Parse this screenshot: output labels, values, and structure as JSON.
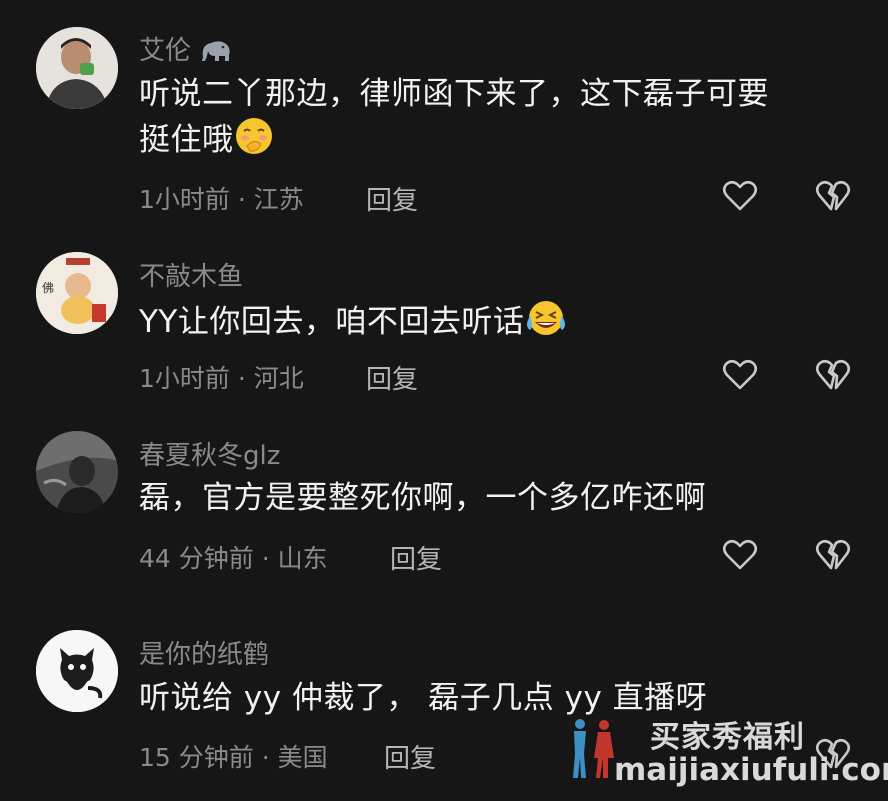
{
  "comments": [
    {
      "username": "艾伦",
      "username_badge": "elephant-icon",
      "text_line1": "听说二丫那边，律师函下来了，这下磊子可要",
      "text_line2": "挺住哦",
      "trailing_emoji": "blush-hand-emoji",
      "time": "1小时前",
      "location": "江苏",
      "reply": "回复"
    },
    {
      "username": "不敲木鱼",
      "text_line1": "YY让你回去，咱不回去听话",
      "trailing_emoji": "laughing-tears-emoji",
      "time": "1小时前",
      "location": "河北",
      "reply": "回复"
    },
    {
      "username": "春夏秋冬glz",
      "text_line1": "磊，官方是要整死你啊，一个多亿咋还啊",
      "time": "44 分钟前",
      "location": "山东",
      "reply": "回复"
    },
    {
      "username": "是你的纸鹤",
      "text_line1": "听说给 yy 仲裁了， 磊子几点 yy 直播呀",
      "time": "15 分钟前",
      "location": "美国",
      "reply": "回复"
    }
  ],
  "separator": " · ",
  "watermark": {
    "title": "买家秀福利",
    "url": "maijiaxiufuli.com"
  },
  "colors": {
    "background": "#161616",
    "text_primary": "#f2f2f2",
    "text_secondary": "#8a8a8a",
    "icon": "#c9c9c9"
  }
}
